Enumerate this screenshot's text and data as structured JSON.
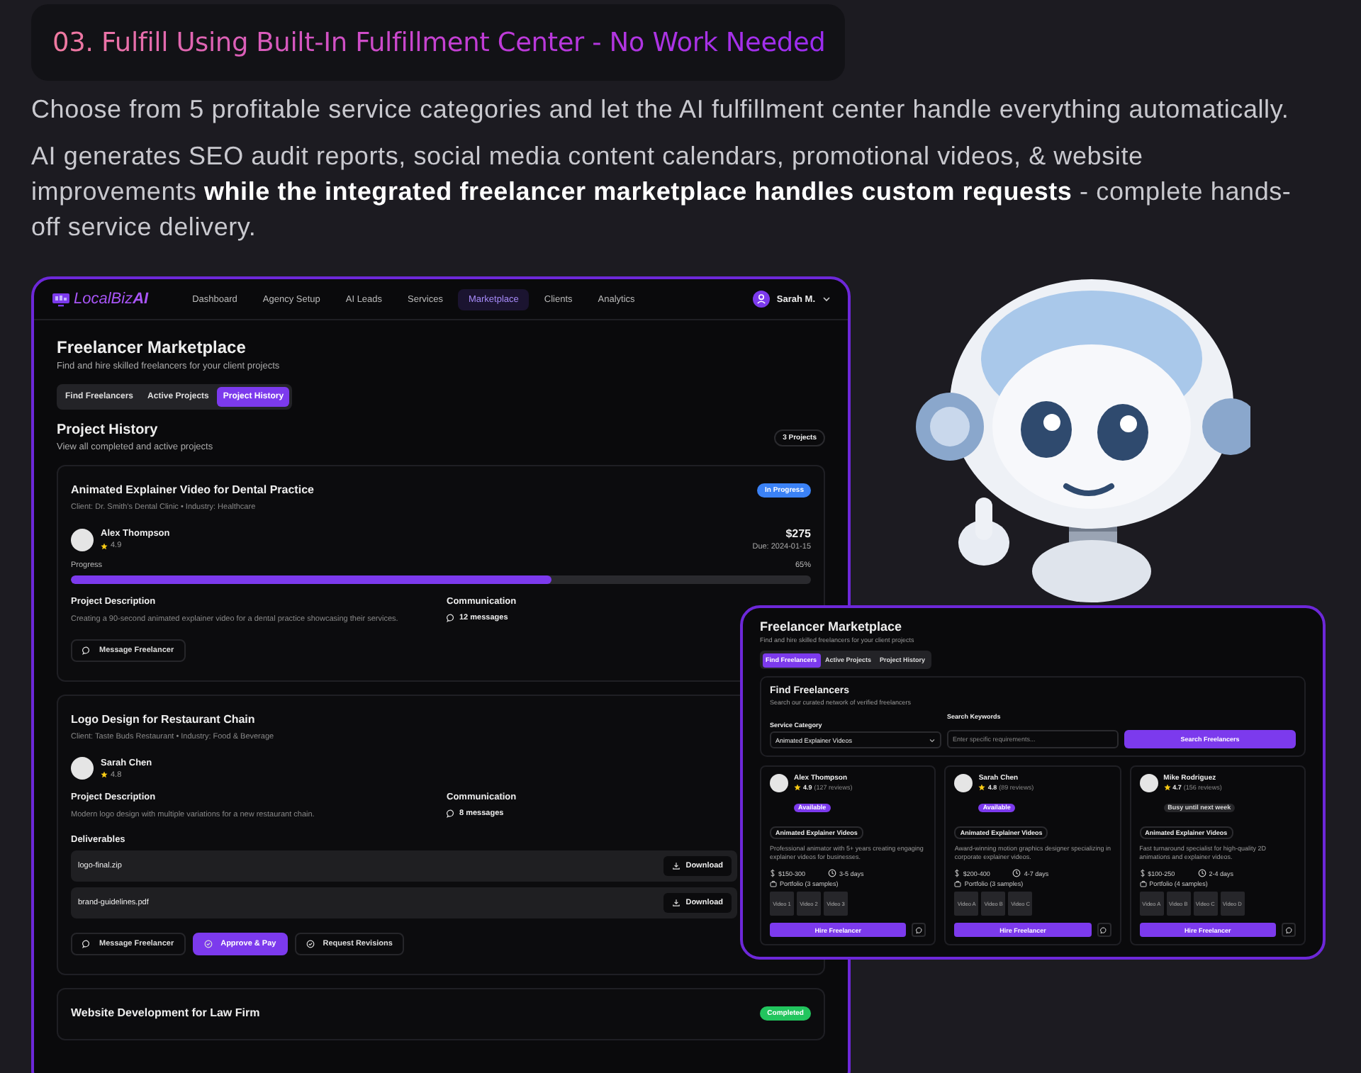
{
  "heading": "03. Fulfill Using Built-In Fulfillment Center - No Work Needed",
  "paragraphs": [
    "Choose from 5 profitable service categories and let the AI fulfillment center handle everything automatically.",
    "AI generates SEO audit reports, social media content calendars, promotional videos, & website improvements **while the integrated freelancer marketplace handles custom requests** - complete hands-off service delivery."
  ],
  "main_screen": {
    "brand": "LocalBiz**AI**",
    "nav": [
      {
        "label": "Dashboard",
        "selected": false
      },
      {
        "label": "Agency Setup",
        "selected": false
      },
      {
        "label": "AI Leads",
        "selected": false
      },
      {
        "label": "Services",
        "selected": false
      },
      {
        "label": "Marketplace",
        "selected": true
      },
      {
        "label": "Clients",
        "selected": false
      },
      {
        "label": "Analytics",
        "selected": false
      }
    ],
    "user": "Sarah M.",
    "title": "Freelancer Marketplace",
    "subtitle": "Find and hire skilled freelancers for your client projects",
    "tabs": [
      {
        "label": "Find Freelancers",
        "selected": false
      },
      {
        "label": "Active Projects",
        "selected": false
      },
      {
        "label": "Project History",
        "selected": true
      }
    ],
    "section_title": "Project History",
    "section_subtitle": "View all completed and active projects",
    "count": "3 Projects",
    "projects": [
      {
        "title": "Animated Explainer Video for Dental Practice",
        "client": "Client: Dr. Smith's Dental Clinic • Industry: Healthcare",
        "status": "In Progress",
        "color": "#3b82f6",
        "freelancer": "Alex Thompson",
        "rating": "4.9",
        "price": "$275",
        "due": "Due: 2024-01-15",
        "progress_label": "Progress",
        "progress_value": "65%",
        "level": 0.65,
        "description_label": "Project Description",
        "description": "Creating a 90-second animated explainer video for a dental practice showcasing their services.",
        "communication_label": "Communication",
        "messages": "12 messages",
        "actions": [
          {
            "label": "Message Freelancer",
            "kind": "message"
          }
        ]
      },
      {
        "title": "Logo Design for Restaurant Chain",
        "client": "Client: Taste Buds Restaurant • Industry: Food & Beverage",
        "freelancer": "Sarah Chen",
        "rating": "4.8",
        "description_label": "Project Description",
        "description": "Modern logo design with multiple variations for a new restaurant chain.",
        "communication_label": "Communication",
        "messages": "8 messages",
        "deliverables_label": "Deliverables",
        "deliverables": [
          {
            "file": "logo-final.zip",
            "action": "Download"
          },
          {
            "file": "brand-guidelines.pdf",
            "action": "Download"
          }
        ],
        "actions": [
          {
            "label": "Message Freelancer",
            "kind": "message"
          },
          {
            "label": "Approve & Pay",
            "kind": "approve"
          },
          {
            "label": "Request Revisions",
            "kind": "revisions"
          }
        ]
      },
      {
        "title": "Website Development for Law Firm",
        "status": "Completed",
        "color": "#22c55e"
      }
    ]
  },
  "overlay": {
    "title": "Freelancer Marketplace",
    "subtitle": "Find and hire skilled freelancers for your client projects",
    "tabs": [
      {
        "label": "Find Freelancers",
        "selected": true
      },
      {
        "label": "Active Projects",
        "selected": false
      },
      {
        "label": "Project History",
        "selected": false
      }
    ],
    "panel_title": "Find Freelancers",
    "panel_subtitle": "Search our curated network of verified freelancers",
    "category_label": "Service Category",
    "category_value": "Animated Explainer Videos",
    "keywords_label": "Search Keywords",
    "keywords_placeholder": "Enter specific requirements...",
    "search_button": "Search Freelancers",
    "freelancers": [
      {
        "name": "Alex Thompson",
        "rating": "4.9",
        "reviews": "(127 reviews)",
        "availability": "Available",
        "available": true,
        "category": "Animated Explainer Videos",
        "bio": "Professional animator with 5+ years creating engaging explainer videos for businesses.",
        "price": "$150-300",
        "time": "3-5 days",
        "portfolio": "Portfolio (3 samples)",
        "samples": [
          "Video 1",
          "Video 2",
          "Video 3"
        ],
        "hire": "Hire Freelancer"
      },
      {
        "name": "Sarah Chen",
        "rating": "4.8",
        "reviews": "(89 reviews)",
        "availability": "Available",
        "available": true,
        "category": "Animated Explainer Videos",
        "bio": "Award-winning motion graphics designer specializing in corporate explainer videos.",
        "price": "$200-400",
        "time": "4-7 days",
        "portfolio": "Portfolio (3 samples)",
        "samples": [
          "Video A",
          "Video B",
          "Video C"
        ],
        "hire": "Hire Freelancer"
      },
      {
        "name": "Mike Rodriguez",
        "rating": "4.7",
        "reviews": "(156 reviews)",
        "availability": "Busy until next week",
        "available": false,
        "category": "Animated Explainer Videos",
        "bio": "Fast turnaround specialist for high-quality 2D animations and explainer videos.",
        "price": "$100-250",
        "time": "2-4 days",
        "portfolio": "Portfolio (4 samples)",
        "samples": [
          "Video A",
          "Video B",
          "Video C",
          "Video D"
        ],
        "hire": "Hire Freelancer"
      }
    ]
  }
}
